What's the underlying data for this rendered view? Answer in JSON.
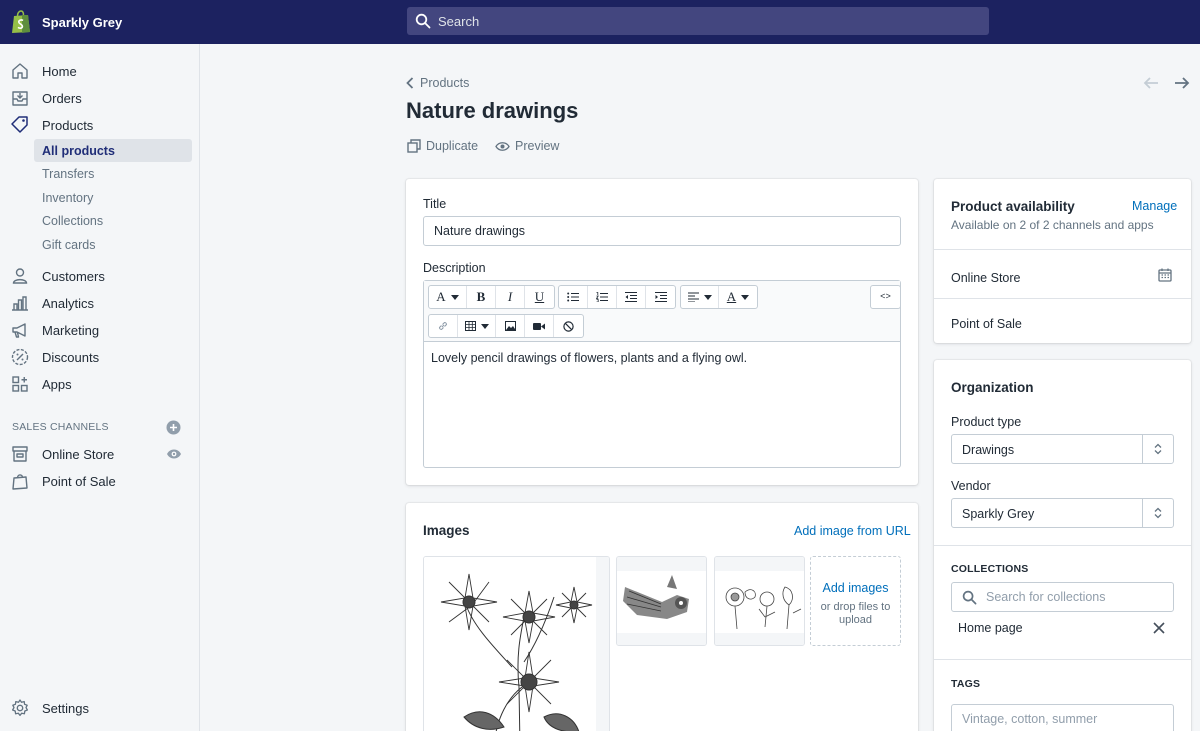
{
  "topbar": {
    "store_name": "Sparkly Grey",
    "search_placeholder": "Search",
    "logo_icon": "shopify-bag-icon"
  },
  "sidebar": {
    "items": [
      {
        "label": "Home",
        "icon": "home-icon"
      },
      {
        "label": "Orders",
        "icon": "orders-icon"
      },
      {
        "label": "Products",
        "icon": "tag-icon"
      },
      {
        "label": "Customers",
        "icon": "person-icon"
      },
      {
        "label": "Analytics",
        "icon": "bar-chart-icon"
      },
      {
        "label": "Marketing",
        "icon": "megaphone-icon"
      },
      {
        "label": "Discounts",
        "icon": "discount-icon"
      },
      {
        "label": "Apps",
        "icon": "apps-icon"
      }
    ],
    "product_subitems": [
      "All products",
      "Transfers",
      "Inventory",
      "Collections",
      "Gift cards"
    ],
    "active_subitem": "All products",
    "sales_channels_heading": "SALES CHANNELS",
    "channels": [
      {
        "label": "Online Store",
        "icon": "store-icon"
      },
      {
        "label": "Point of Sale",
        "icon": "pos-icon"
      }
    ],
    "settings_label": "Settings"
  },
  "header": {
    "breadcrumb": "Products",
    "title": "Nature drawings",
    "actions": [
      {
        "label": "Duplicate",
        "icon": "duplicate-icon"
      },
      {
        "label": "Preview",
        "icon": "eye-icon"
      }
    ]
  },
  "product_form": {
    "title_label": "Title",
    "title_value": "Nature drawings",
    "description_label": "Description",
    "description_value": "Lovely pencil drawings of flowers, plants and a flying owl."
  },
  "images": {
    "heading": "Images",
    "add_from_url": "Add image from URL",
    "add_images": "Add images",
    "drop_hint": "or drop files to upload",
    "thumbnails": [
      "flower-drawing",
      "owl-drawing",
      "plant-drawing"
    ]
  },
  "availability": {
    "heading": "Product availability",
    "manage": "Manage",
    "summary": "Available on 2 of 2 channels and apps",
    "channels": [
      "Online Store",
      "Point of Sale"
    ]
  },
  "organization": {
    "heading": "Organization",
    "product_type_label": "Product type",
    "product_type_value": "Drawings",
    "vendor_label": "Vendor",
    "vendor_value": "Sparkly Grey",
    "collections_heading": "COLLECTIONS",
    "collections_search_placeholder": "Search for collections",
    "collections": [
      "Home page"
    ],
    "tags_heading": "TAGS",
    "tags_placeholder": "Vintage, cotton, summer"
  },
  "colors": {
    "topbar": "#1c2260",
    "link": "#006fbb",
    "active_nav": "#202e78"
  }
}
